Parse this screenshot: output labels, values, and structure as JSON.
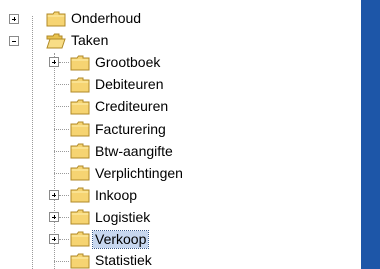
{
  "tree": {
    "onderhoud": "Onderhoud",
    "taken": "Taken",
    "grootboek": "Grootboek",
    "debiteuren": "Debiteuren",
    "crediteuren": "Crediteuren",
    "facturering": "Facturering",
    "btw_aangifte": "Btw-aangifte",
    "verplichtingen": "Verplichtingen",
    "inkoop": "Inkoop",
    "logistiek": "Logistiek",
    "verkoop": "Verkoop",
    "statistiek": "Statistiek"
  },
  "selected_item": "Verkoop"
}
